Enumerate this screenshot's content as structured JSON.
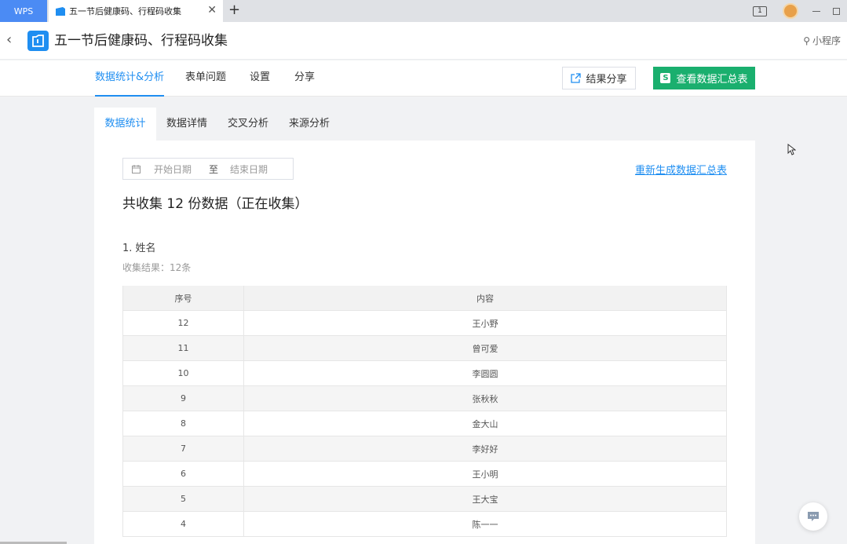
{
  "browser": {
    "wps_label": "WPS",
    "tab_title": "五一节后健康码、行程码收集",
    "tab_close": "✕",
    "new_tab": "+",
    "badge": "1"
  },
  "header": {
    "title": "五一节后健康码、行程码收集",
    "mini_program": "小程序"
  },
  "nav": {
    "items": [
      "数据统计&分析",
      "表单问题",
      "设置",
      "分享"
    ],
    "active": 0,
    "share_result": "结果分享",
    "view_summary": "查看数据汇总表",
    "sheet_glyph": "S"
  },
  "subtabs": {
    "items": [
      "数据统计",
      "数据详情",
      "交叉分析",
      "来源分析"
    ],
    "active": 0
  },
  "filter": {
    "start_placeholder": "开始日期",
    "separator": "至",
    "end_placeholder": "结束日期",
    "regenerate": "重新生成数据汇总表"
  },
  "summary": {
    "total_text": "共收集 12 份数据（正在收集）"
  },
  "question": {
    "title": "1. 姓名",
    "result": "收集结果：12条"
  },
  "table": {
    "headers": [
      "序号",
      "内容"
    ],
    "rows": [
      [
        "12",
        "王小野"
      ],
      [
        "11",
        "曾可爱"
      ],
      [
        "10",
        "李圆圆"
      ],
      [
        "9",
        "张秋秋"
      ],
      [
        "8",
        "金大山"
      ],
      [
        "7",
        "李好好"
      ],
      [
        "6",
        "王小明"
      ],
      [
        "5",
        "王大宝"
      ],
      [
        "4",
        "陈一一"
      ]
    ]
  },
  "colors": {
    "accent": "#1f8ef1",
    "green": "#1aaf6e",
    "wps_tab": "#4b8bf4"
  }
}
